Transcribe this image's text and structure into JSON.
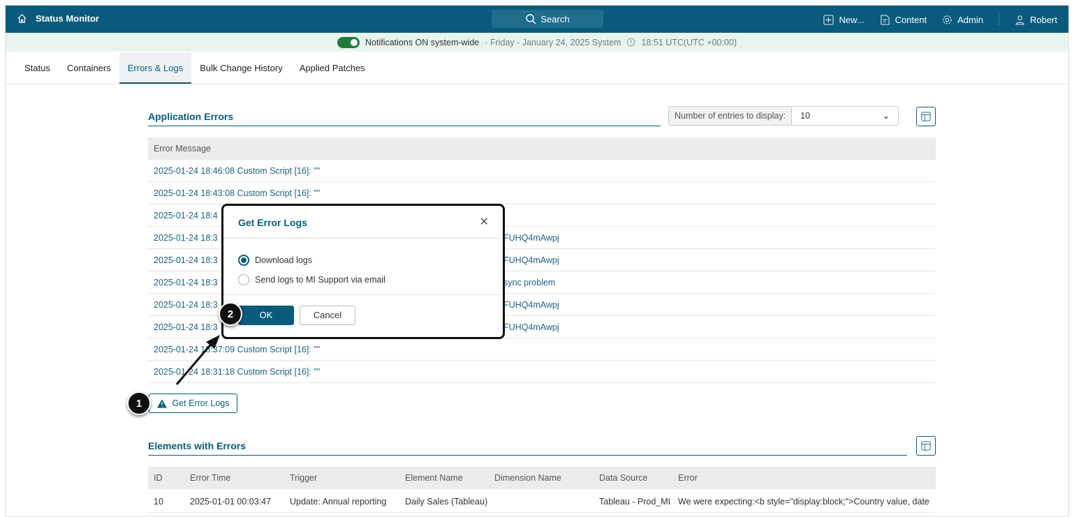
{
  "header": {
    "title": "Status Monitor",
    "search": "Search",
    "new": "New...",
    "content": "Content",
    "admin": "Admin",
    "user": "Robert"
  },
  "notification": {
    "status": "Notifications ON system-wide",
    "date": "· Friday - January 24, 2025 System",
    "time": "18:51 UTC(UTC +00:00)"
  },
  "tabs": [
    "Status",
    "Containers",
    "Errors & Logs",
    "Bulk Change History",
    "Applied Patches"
  ],
  "app_errors": {
    "title": "Application Errors",
    "entries_label": "Number of entries to display:",
    "entries_value": "10",
    "column": "Error Message",
    "rows": [
      {
        "left": "2025-01-24 18:46:08 Custom Script [16]: \"\"",
        "right": ""
      },
      {
        "left": "2025-01-24 18:43:08 Custom Script [16]: \"\"",
        "right": ""
      },
      {
        "left": "2025-01-24 18:4",
        "right": ""
      },
      {
        "left": "2025-01-24 18:3",
        "right": "FUHQ4mAwpj"
      },
      {
        "left": "2025-01-24 18:3",
        "right": "FUHQ4mAwpj"
      },
      {
        "left": "2025-01-24 18:3",
        "right": "sync problem"
      },
      {
        "left": "2025-01-24 18:3",
        "right": "FUHQ4mAwpj"
      },
      {
        "left": "2025-01-24 18:3",
        "right": "FUHQ4mAwpj"
      },
      {
        "left": "2025-01-24 18:37:09 Custom Script [16]: \"\"",
        "right": ""
      },
      {
        "left": "2025-01-24 18:31:18 Custom Script [16]: \"\"",
        "right": ""
      }
    ],
    "get_logs": "Get Error Logs"
  },
  "dialog": {
    "title": "Get Error Logs",
    "options": [
      "Download logs",
      "Send logs to MI Support via email"
    ],
    "ok": "OK",
    "cancel": "Cancel"
  },
  "badges": [
    "1",
    "2"
  ],
  "elements": {
    "title": "Elements with Errors",
    "columns": [
      "ID",
      "Error Time",
      "Trigger",
      "Element Name",
      "Dimension Name",
      "Data Source",
      "Error"
    ],
    "rows": [
      [
        "10",
        "2025-01-01 00:03:47",
        "Update: Annual reporting",
        "Daily Sales (Tableau)",
        "",
        "Tableau - Prod_MI",
        "We were expecting:<b style=\"display:block;\">Country value, date"
      ]
    ]
  },
  "colors": {
    "primary": "#0a5a7c",
    "notif_bg": "#eaf4ee",
    "toggle": "#1e7a3c"
  }
}
